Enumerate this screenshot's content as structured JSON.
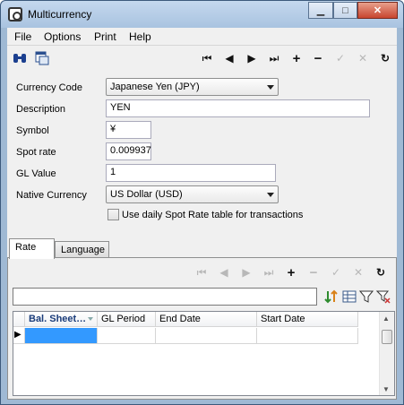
{
  "window": {
    "title": "Multicurrency"
  },
  "window_buttons": {
    "minimize": "▁",
    "maximize": "□",
    "close": "✕"
  },
  "menu": [
    "File",
    "Options",
    "Print",
    "Help"
  ],
  "toolbar": {
    "left_icons": [
      "binoculars-icon",
      "window-list-icon"
    ],
    "nav_icons": {
      "first": "⏮",
      "prev": "◀",
      "next": "▶",
      "last": "⏭",
      "add": "+",
      "remove": "−",
      "confirm": "✓",
      "cancel": "✕",
      "refresh": "↻"
    }
  },
  "form": {
    "currency_code_label": "Currency Code",
    "currency_code_value": "Japanese Yen  (JPY)",
    "description_label": "Description",
    "description_value": "YEN",
    "symbol_label": "Symbol",
    "symbol_value": "¥",
    "spot_rate_label": "Spot rate",
    "spot_rate_value": "0.009937",
    "gl_value_label": "GL Value",
    "gl_value_value": "1",
    "native_currency_label": "Native Currency",
    "native_currency_value": "US Dollar  (USD)",
    "daily_spot_label": "Use daily Spot Rate table for transactions",
    "daily_spot_checked": false
  },
  "tabs": [
    {
      "label": "Rate",
      "active": true
    },
    {
      "label": "Language",
      "active": false
    }
  ],
  "grid": {
    "filter_value": "",
    "columns": [
      "Bal. Sheet…",
      "GL Period",
      "End Date",
      "Start Date"
    ],
    "row_marker": "▶"
  },
  "colors": {
    "titlebar": "#b9cfe8",
    "selected_cell": "#3399ff",
    "client_bg": "#f0f0f0"
  }
}
